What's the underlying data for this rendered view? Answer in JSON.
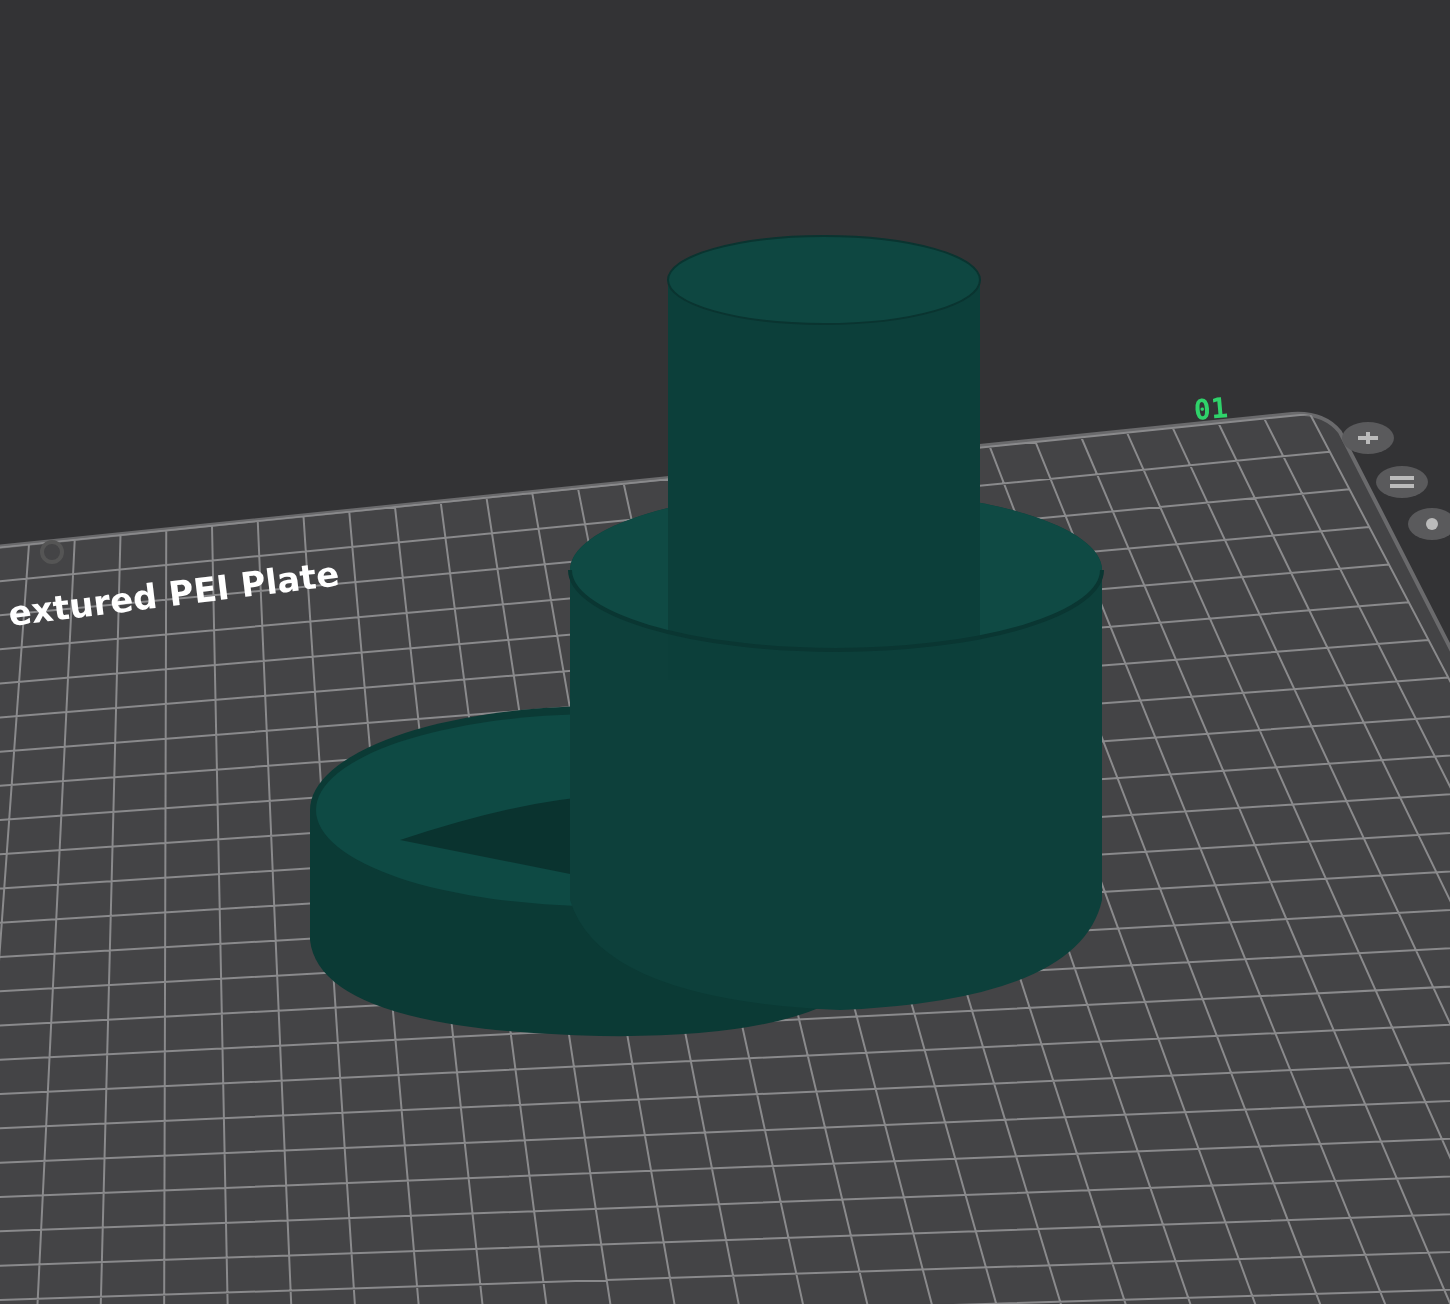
{
  "viewport": {
    "plate_label": "extured PEI Plate",
    "plate_number": "01"
  }
}
